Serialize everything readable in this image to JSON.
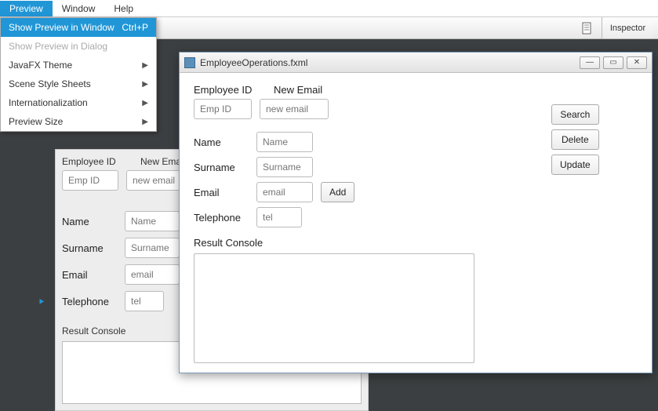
{
  "menubar": {
    "preview": "Preview",
    "window": "Window",
    "help": "Help"
  },
  "dropdown": {
    "show_in_window": "Show Preview in Window",
    "show_in_window_shortcut": "Ctrl+P",
    "show_in_dialog": "Show Preview in Dialog",
    "javafx_theme": "JavaFX Theme",
    "scene_style_sheets": "Scene Style Sheets",
    "internationalization": "Internationalization",
    "preview_size": "Preview Size"
  },
  "inspector": "Inspector",
  "window_title": "EmployeeOperations.fxml",
  "labels": {
    "employee_id": "Employee ID",
    "new_email": "New Email",
    "name": "Name",
    "surname": "Surname",
    "email": "Email",
    "telephone": "Telephone",
    "result_console": "Result Console"
  },
  "placeholders": {
    "emp_id": "Emp ID",
    "new_email": "new email",
    "name": "Name",
    "surname": "Surname",
    "email": "email",
    "tel": "tel"
  },
  "buttons": {
    "search": "Search",
    "delete": "Delete",
    "update": "Update",
    "add": "Add"
  },
  "win_controls": {
    "min": "—",
    "max": "▭",
    "close": "✕"
  }
}
